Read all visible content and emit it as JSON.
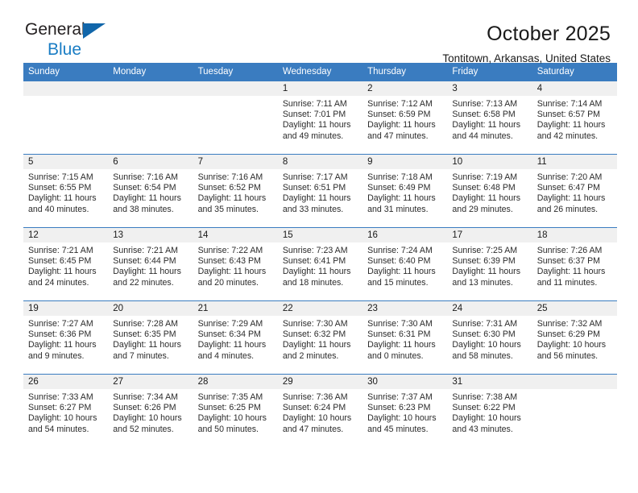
{
  "brand": {
    "name_part1": "General",
    "name_part2": "Blue",
    "triangle_icon": "blue-triangle-icon"
  },
  "header": {
    "title": "October 2025",
    "subtitle": "Tontitown, Arkansas, United States"
  },
  "colors": {
    "header_blue": "#3a7cc0",
    "logo_blue": "#1a7dc4",
    "daynum_band": "#f0f0f0"
  },
  "calendar": {
    "weekday_headers": [
      "Sunday",
      "Monday",
      "Tuesday",
      "Wednesday",
      "Thursday",
      "Friday",
      "Saturday"
    ],
    "weeks": [
      [
        {
          "day": "",
          "lines": []
        },
        {
          "day": "",
          "lines": []
        },
        {
          "day": "",
          "lines": []
        },
        {
          "day": "1",
          "lines": [
            "Sunrise: 7:11 AM",
            "Sunset: 7:01 PM",
            "Daylight: 11 hours",
            "and 49 minutes."
          ]
        },
        {
          "day": "2",
          "lines": [
            "Sunrise: 7:12 AM",
            "Sunset: 6:59 PM",
            "Daylight: 11 hours",
            "and 47 minutes."
          ]
        },
        {
          "day": "3",
          "lines": [
            "Sunrise: 7:13 AM",
            "Sunset: 6:58 PM",
            "Daylight: 11 hours",
            "and 44 minutes."
          ]
        },
        {
          "day": "4",
          "lines": [
            "Sunrise: 7:14 AM",
            "Sunset: 6:57 PM",
            "Daylight: 11 hours",
            "and 42 minutes."
          ]
        }
      ],
      [
        {
          "day": "5",
          "lines": [
            "Sunrise: 7:15 AM",
            "Sunset: 6:55 PM",
            "Daylight: 11 hours",
            "and 40 minutes."
          ]
        },
        {
          "day": "6",
          "lines": [
            "Sunrise: 7:16 AM",
            "Sunset: 6:54 PM",
            "Daylight: 11 hours",
            "and 38 minutes."
          ]
        },
        {
          "day": "7",
          "lines": [
            "Sunrise: 7:16 AM",
            "Sunset: 6:52 PM",
            "Daylight: 11 hours",
            "and 35 minutes."
          ]
        },
        {
          "day": "8",
          "lines": [
            "Sunrise: 7:17 AM",
            "Sunset: 6:51 PM",
            "Daylight: 11 hours",
            "and 33 minutes."
          ]
        },
        {
          "day": "9",
          "lines": [
            "Sunrise: 7:18 AM",
            "Sunset: 6:49 PM",
            "Daylight: 11 hours",
            "and 31 minutes."
          ]
        },
        {
          "day": "10",
          "lines": [
            "Sunrise: 7:19 AM",
            "Sunset: 6:48 PM",
            "Daylight: 11 hours",
            "and 29 minutes."
          ]
        },
        {
          "day": "11",
          "lines": [
            "Sunrise: 7:20 AM",
            "Sunset: 6:47 PM",
            "Daylight: 11 hours",
            "and 26 minutes."
          ]
        }
      ],
      [
        {
          "day": "12",
          "lines": [
            "Sunrise: 7:21 AM",
            "Sunset: 6:45 PM",
            "Daylight: 11 hours",
            "and 24 minutes."
          ]
        },
        {
          "day": "13",
          "lines": [
            "Sunrise: 7:21 AM",
            "Sunset: 6:44 PM",
            "Daylight: 11 hours",
            "and 22 minutes."
          ]
        },
        {
          "day": "14",
          "lines": [
            "Sunrise: 7:22 AM",
            "Sunset: 6:43 PM",
            "Daylight: 11 hours",
            "and 20 minutes."
          ]
        },
        {
          "day": "15",
          "lines": [
            "Sunrise: 7:23 AM",
            "Sunset: 6:41 PM",
            "Daylight: 11 hours",
            "and 18 minutes."
          ]
        },
        {
          "day": "16",
          "lines": [
            "Sunrise: 7:24 AM",
            "Sunset: 6:40 PM",
            "Daylight: 11 hours",
            "and 15 minutes."
          ]
        },
        {
          "day": "17",
          "lines": [
            "Sunrise: 7:25 AM",
            "Sunset: 6:39 PM",
            "Daylight: 11 hours",
            "and 13 minutes."
          ]
        },
        {
          "day": "18",
          "lines": [
            "Sunrise: 7:26 AM",
            "Sunset: 6:37 PM",
            "Daylight: 11 hours",
            "and 11 minutes."
          ]
        }
      ],
      [
        {
          "day": "19",
          "lines": [
            "Sunrise: 7:27 AM",
            "Sunset: 6:36 PM",
            "Daylight: 11 hours",
            "and 9 minutes."
          ]
        },
        {
          "day": "20",
          "lines": [
            "Sunrise: 7:28 AM",
            "Sunset: 6:35 PM",
            "Daylight: 11 hours",
            "and 7 minutes."
          ]
        },
        {
          "day": "21",
          "lines": [
            "Sunrise: 7:29 AM",
            "Sunset: 6:34 PM",
            "Daylight: 11 hours",
            "and 4 minutes."
          ]
        },
        {
          "day": "22",
          "lines": [
            "Sunrise: 7:30 AM",
            "Sunset: 6:32 PM",
            "Daylight: 11 hours",
            "and 2 minutes."
          ]
        },
        {
          "day": "23",
          "lines": [
            "Sunrise: 7:30 AM",
            "Sunset: 6:31 PM",
            "Daylight: 11 hours",
            "and 0 minutes."
          ]
        },
        {
          "day": "24",
          "lines": [
            "Sunrise: 7:31 AM",
            "Sunset: 6:30 PM",
            "Daylight: 10 hours",
            "and 58 minutes."
          ]
        },
        {
          "day": "25",
          "lines": [
            "Sunrise: 7:32 AM",
            "Sunset: 6:29 PM",
            "Daylight: 10 hours",
            "and 56 minutes."
          ]
        }
      ],
      [
        {
          "day": "26",
          "lines": [
            "Sunrise: 7:33 AM",
            "Sunset: 6:27 PM",
            "Daylight: 10 hours",
            "and 54 minutes."
          ]
        },
        {
          "day": "27",
          "lines": [
            "Sunrise: 7:34 AM",
            "Sunset: 6:26 PM",
            "Daylight: 10 hours",
            "and 52 minutes."
          ]
        },
        {
          "day": "28",
          "lines": [
            "Sunrise: 7:35 AM",
            "Sunset: 6:25 PM",
            "Daylight: 10 hours",
            "and 50 minutes."
          ]
        },
        {
          "day": "29",
          "lines": [
            "Sunrise: 7:36 AM",
            "Sunset: 6:24 PM",
            "Daylight: 10 hours",
            "and 47 minutes."
          ]
        },
        {
          "day": "30",
          "lines": [
            "Sunrise: 7:37 AM",
            "Sunset: 6:23 PM",
            "Daylight: 10 hours",
            "and 45 minutes."
          ]
        },
        {
          "day": "31",
          "lines": [
            "Sunrise: 7:38 AM",
            "Sunset: 6:22 PM",
            "Daylight: 10 hours",
            "and 43 minutes."
          ]
        },
        {
          "day": "",
          "lines": []
        }
      ]
    ]
  }
}
